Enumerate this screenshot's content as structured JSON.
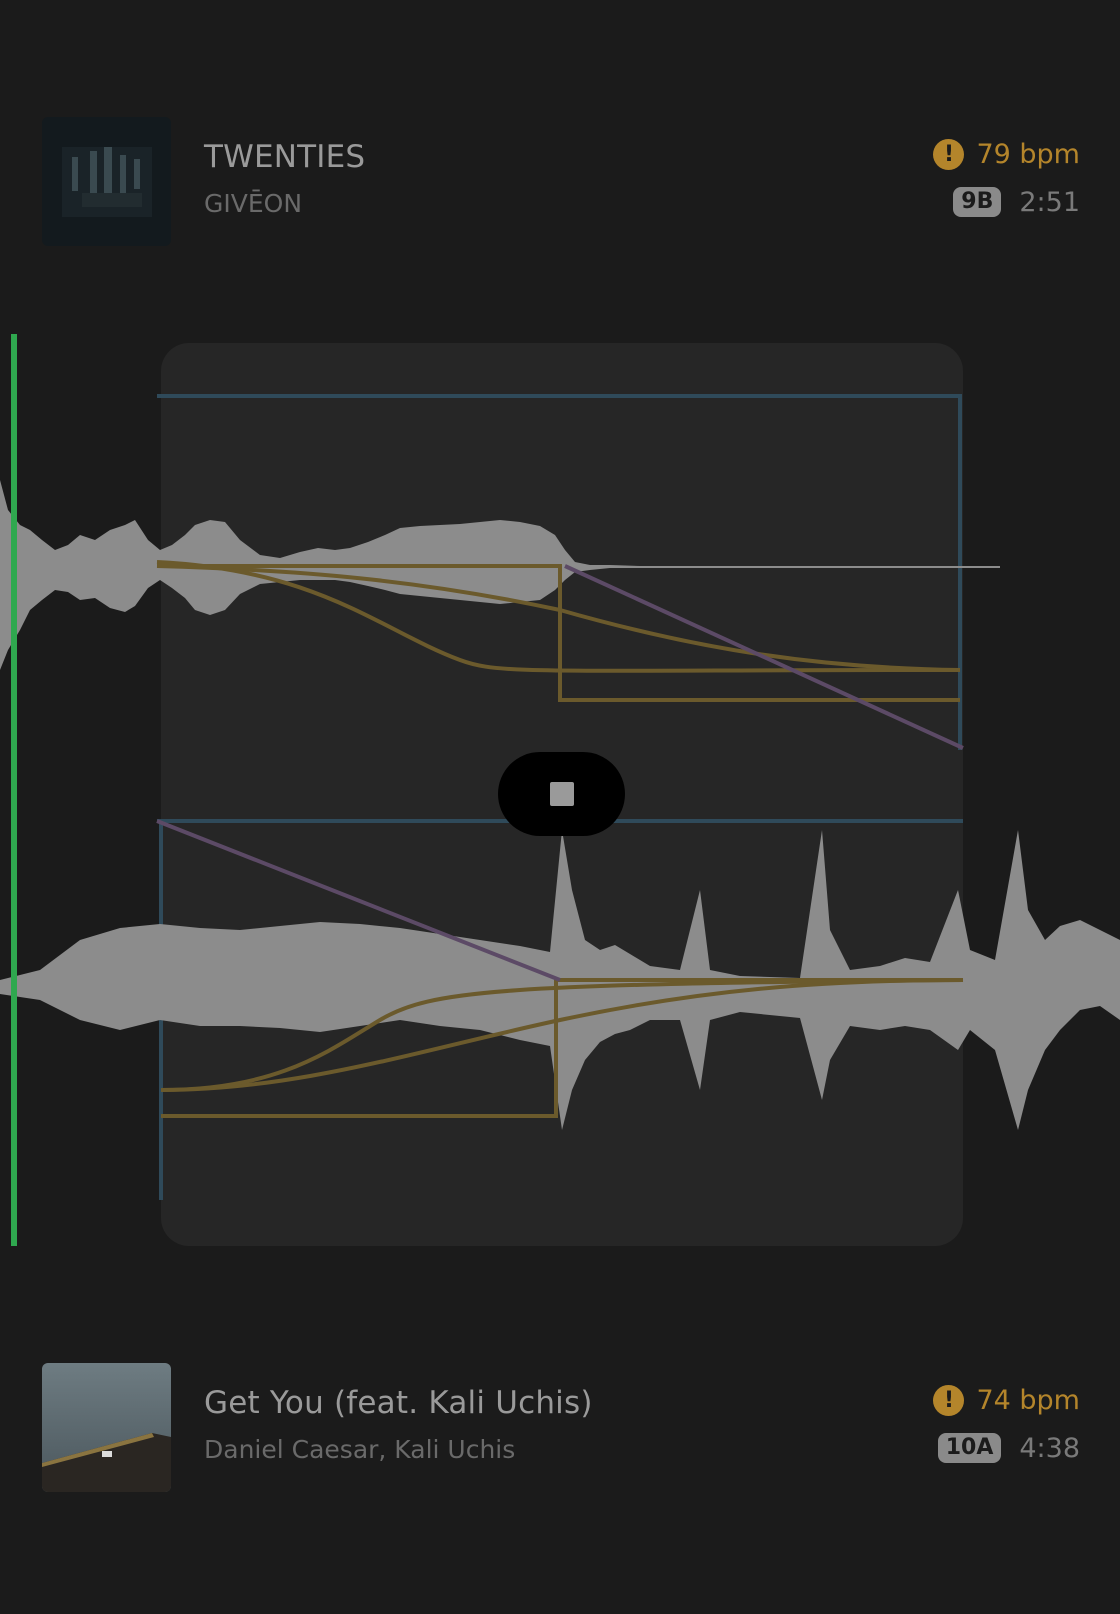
{
  "tracks": [
    {
      "title": "TWENTIES",
      "artist": "GIVĒON",
      "bpm": "79 bpm",
      "key": "9B",
      "duration": "2:51"
    },
    {
      "title": "Get You (feat. Kali Uchis)",
      "artist": "Daniel Caesar, Kali Uchis",
      "bpm": "74 bpm",
      "key": "10A",
      "duration": "4:38"
    }
  ],
  "icons": {
    "warning": "warning-icon",
    "stop": "stop-icon"
  },
  "colors": {
    "background": "#1b1b1b",
    "transition_panel": "#262626",
    "waveform": "#8c8c8c",
    "playhead": "#2fa84f",
    "eq_curve": "#6b5a2c",
    "volume_curve": "#5c4a66",
    "region_border": "#2f4a5a",
    "bpm_warning": "#b4852b"
  }
}
